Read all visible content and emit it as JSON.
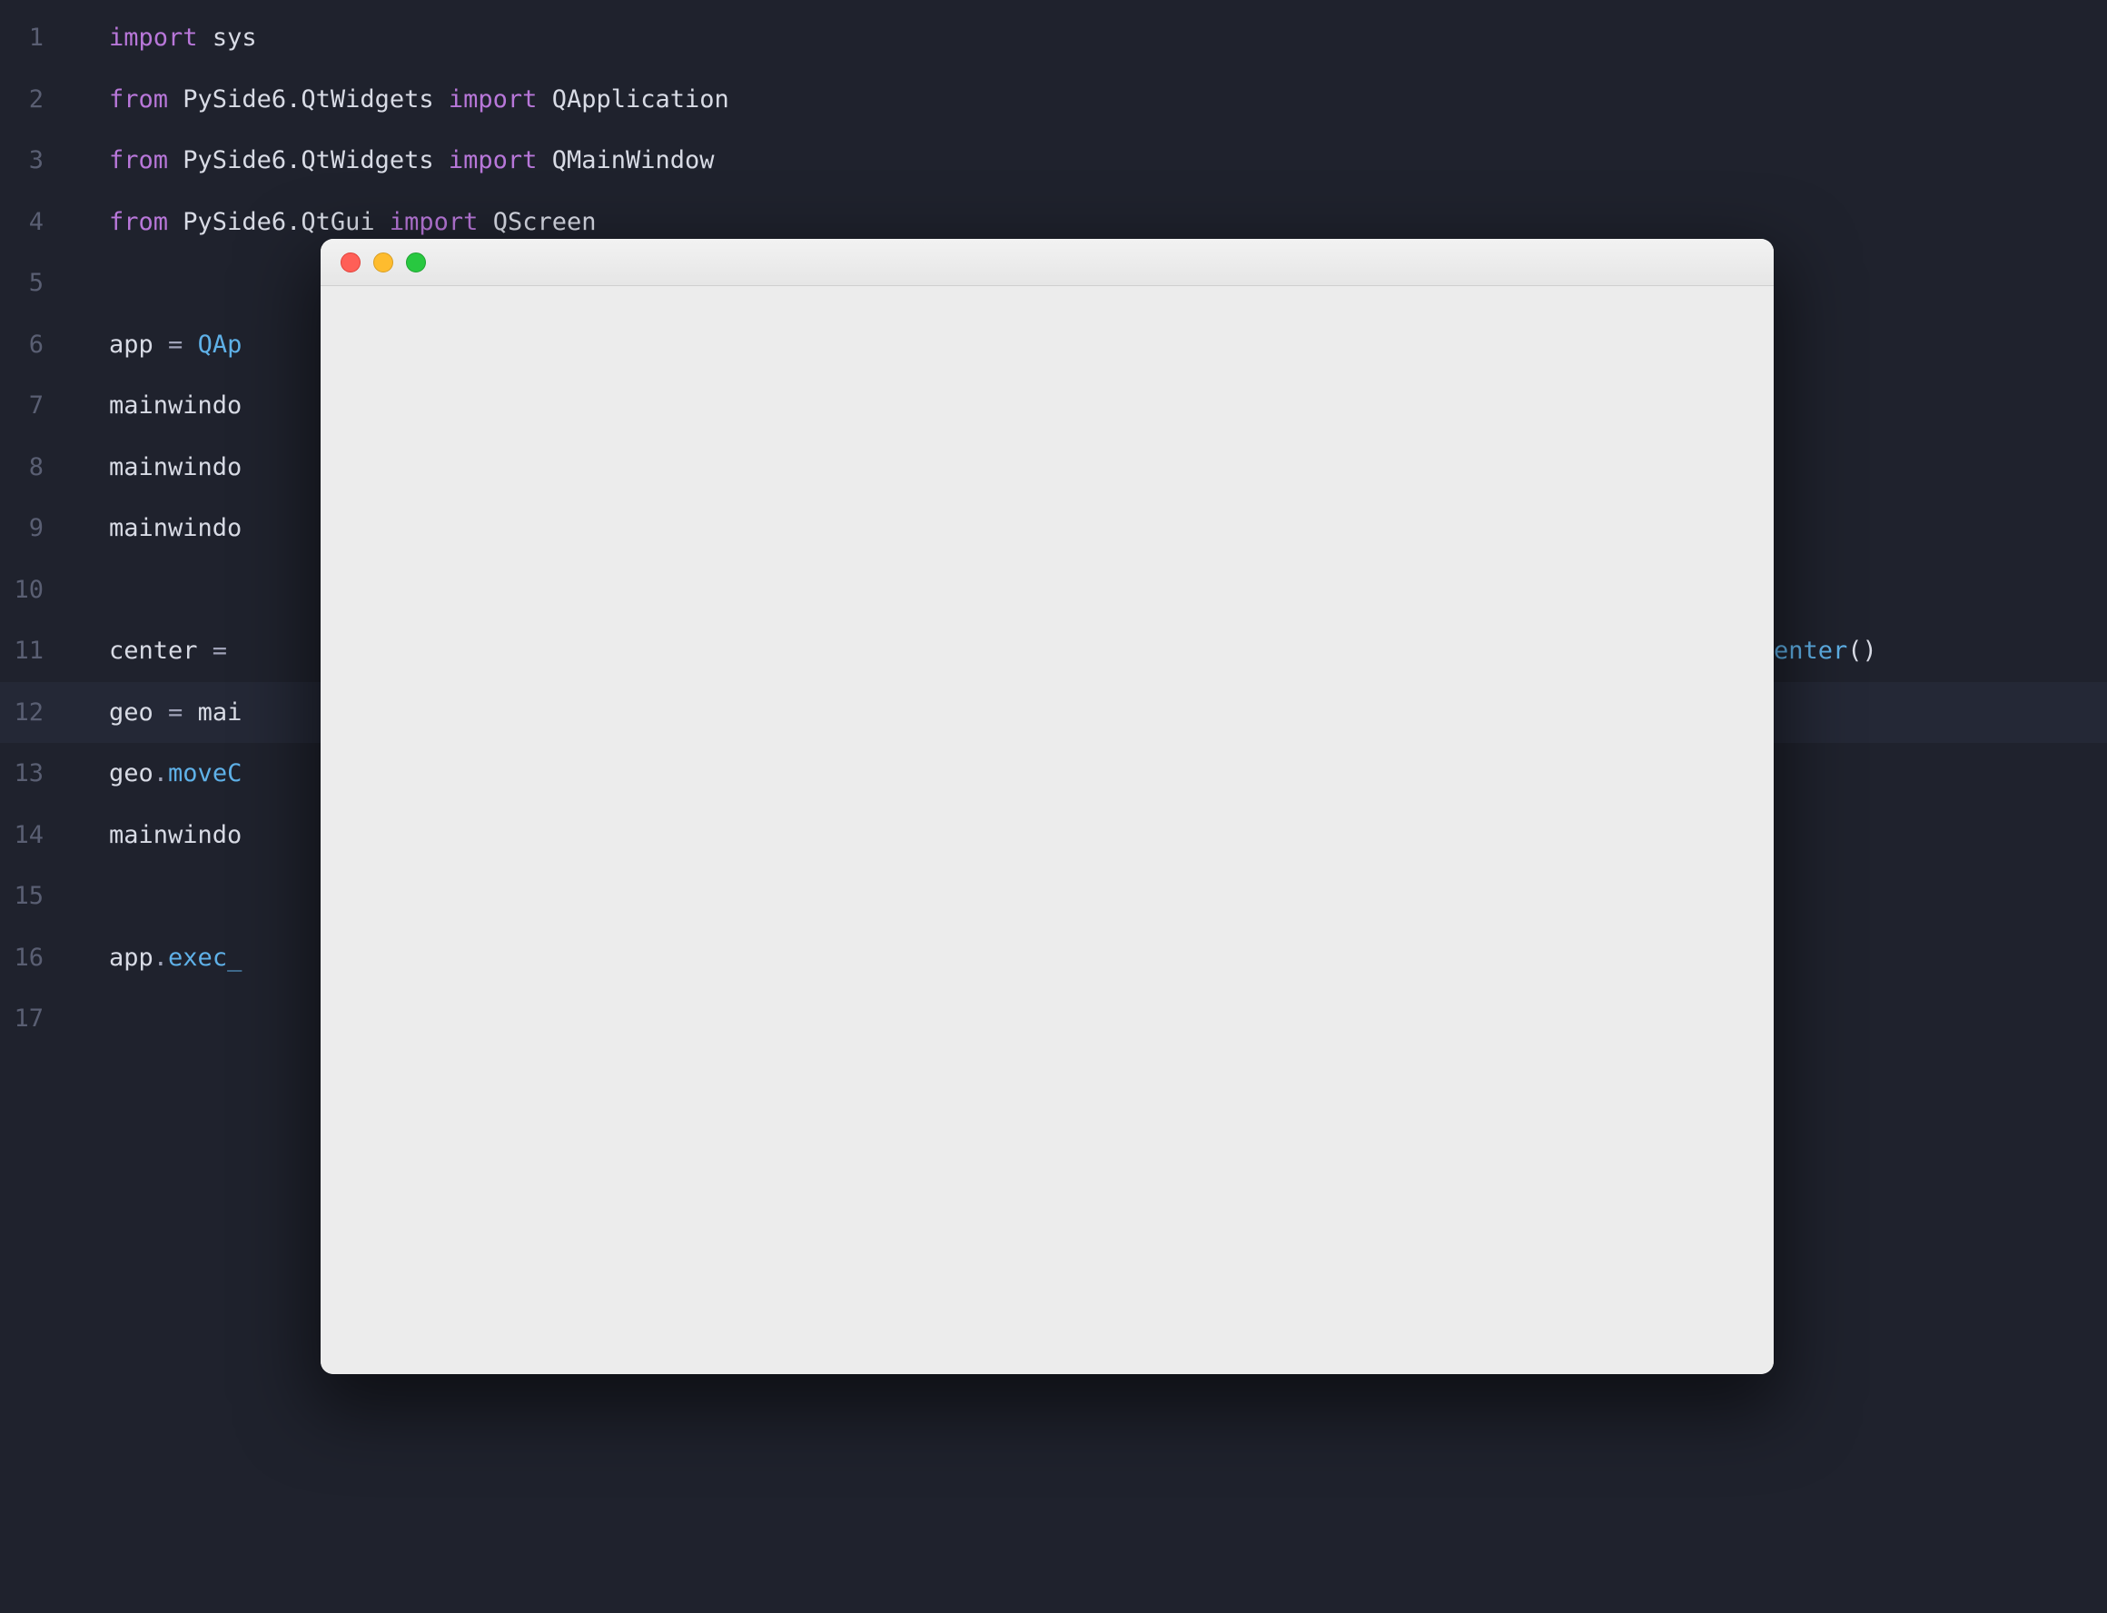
{
  "lines": [
    {
      "n": "1",
      "tokens": [
        {
          "t": "import",
          "c": "kw"
        },
        {
          "t": " "
        },
        {
          "t": "sys",
          "c": "mod"
        }
      ]
    },
    {
      "n": "2",
      "tokens": [
        {
          "t": "from",
          "c": "kw"
        },
        {
          "t": " "
        },
        {
          "t": "PySide6.QtWidgets",
          "c": "mod"
        },
        {
          "t": " "
        },
        {
          "t": "import",
          "c": "kw"
        },
        {
          "t": " "
        },
        {
          "t": "QApplication",
          "c": "mod"
        }
      ]
    },
    {
      "n": "3",
      "tokens": [
        {
          "t": "from",
          "c": "kw"
        },
        {
          "t": " "
        },
        {
          "t": "PySide6.QtWidgets",
          "c": "mod"
        },
        {
          "t": " "
        },
        {
          "t": "import",
          "c": "kw"
        },
        {
          "t": " "
        },
        {
          "t": "QMainWindow",
          "c": "mod"
        }
      ]
    },
    {
      "n": "4",
      "tokens": [
        {
          "t": "from",
          "c": "kw"
        },
        {
          "t": " "
        },
        {
          "t": "PySide6.QtGui",
          "c": "mod"
        },
        {
          "t": " "
        },
        {
          "t": "import",
          "c": "kw"
        },
        {
          "t": " "
        },
        {
          "t": "QScreen",
          "c": "mod"
        }
      ]
    },
    {
      "n": "5",
      "tokens": []
    },
    {
      "n": "6",
      "tokens": [
        {
          "t": "app ",
          "c": "mod"
        },
        {
          "t": "=",
          "c": "op"
        },
        {
          "t": " "
        },
        {
          "t": "QAp",
          "c": "fn"
        }
      ]
    },
    {
      "n": "7",
      "tokens": [
        {
          "t": "mainwindo",
          "c": "mod"
        }
      ]
    },
    {
      "n": "8",
      "tokens": [
        {
          "t": "mainwindo",
          "c": "mod"
        }
      ]
    },
    {
      "n": "9",
      "tokens": [
        {
          "t": "mainwindo",
          "c": "mod"
        }
      ]
    },
    {
      "n": "10",
      "tokens": []
    },
    {
      "n": "11",
      "tokens": [
        {
          "t": "center ",
          "c": "mod"
        },
        {
          "t": "=",
          "c": "op"
        },
        {
          "t": " "
        }
      ],
      "tail": [
        {
          "t": "enter",
          "c": "fn"
        },
        {
          "t": "()",
          "c": "mod"
        }
      ]
    },
    {
      "n": "12",
      "current": true,
      "tokens": [
        {
          "t": "geo ",
          "c": "mod"
        },
        {
          "t": "=",
          "c": "op"
        },
        {
          "t": " "
        },
        {
          "t": "mai",
          "c": "mod"
        }
      ]
    },
    {
      "n": "13",
      "tokens": [
        {
          "t": "geo",
          "c": "mod"
        },
        {
          "t": ".",
          "c": "op"
        },
        {
          "t": "moveC",
          "c": "fn"
        }
      ]
    },
    {
      "n": "14",
      "tokens": [
        {
          "t": "mainwindo",
          "c": "mod"
        }
      ]
    },
    {
      "n": "15",
      "tokens": []
    },
    {
      "n": "16",
      "tokens": [
        {
          "t": "app",
          "c": "mod"
        },
        {
          "t": ".",
          "c": "op"
        },
        {
          "t": "exec_",
          "c": "fn"
        }
      ]
    },
    {
      "n": "17",
      "tokens": []
    }
  ],
  "window": {
    "title": ""
  }
}
